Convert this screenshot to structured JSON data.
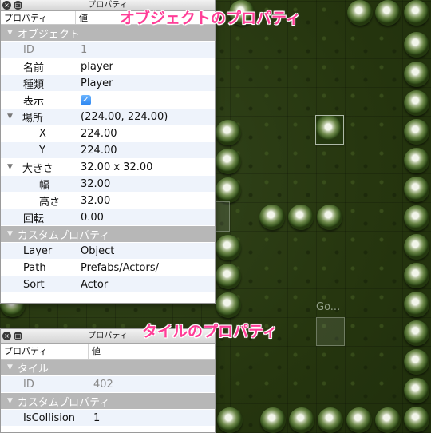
{
  "window_title": "プロパティ",
  "columns": {
    "property": "プロパティ",
    "value": "値"
  },
  "object_panel": {
    "section_object": "オブジェクト",
    "id": {
      "label": "ID",
      "value": "1"
    },
    "name": {
      "label": "名前",
      "value": "player"
    },
    "type": {
      "label": "種類",
      "value": "Player"
    },
    "visible": {
      "label": "表示",
      "checked": true
    },
    "position": {
      "label": "場所",
      "value": "(224.00, 224.00)"
    },
    "x": {
      "label": "X",
      "value": "224.00"
    },
    "y": {
      "label": "Y",
      "value": "224.00"
    },
    "size": {
      "label": "大きさ",
      "value": "32.00 x 32.00"
    },
    "width": {
      "label": "幅",
      "value": "32.00"
    },
    "height": {
      "label": "高さ",
      "value": "32.00"
    },
    "rotation": {
      "label": "回転",
      "value": "0.00"
    },
    "section_custom": "カスタムプロパティ",
    "layer": {
      "label": "Layer",
      "value": "Object"
    },
    "path": {
      "label": "Path",
      "value": "Prefabs/Actors/"
    },
    "sort": {
      "label": "Sort",
      "value": "Actor"
    }
  },
  "tile_panel": {
    "section_tile": "タイル",
    "id": {
      "label": "ID",
      "value": "402"
    },
    "section_custom": "カスタムプロパティ",
    "collision": {
      "label": "IsCollision",
      "value": "1"
    }
  },
  "annotations": {
    "object_callout": "オブジェクトのプロパティ",
    "tile_callout": "タイルのプロパティ"
  },
  "map": {
    "object_label": "Go..."
  },
  "icons": {
    "close": "close-icon",
    "detach": "detach-icon",
    "expand": "disclosure-triangle-icon",
    "check": "checkmark-icon"
  },
  "colors": {
    "callout": "#ff3d97",
    "section_header": "#b7b7b7",
    "alt_row": "#eef3fb",
    "checkbox": "#2a84f0"
  }
}
